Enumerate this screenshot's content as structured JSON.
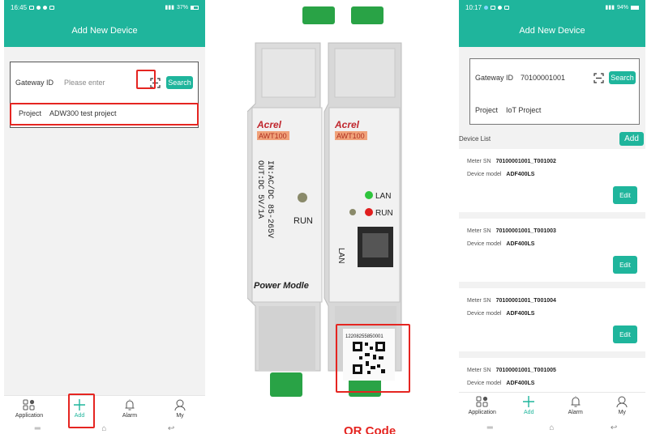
{
  "left_phone": {
    "status_time": "16:45",
    "status_battery": "37%",
    "title": "Add New Device",
    "gateway_label": "Gateway ID",
    "gateway_placeholder": "Please enter",
    "search_label": "Search",
    "project_label": "Project",
    "project_value": "ADW300 test project",
    "nav": [
      {
        "label": "Application",
        "icon": "application-grid-icon"
      },
      {
        "label": "Add",
        "icon": "plus-icon"
      },
      {
        "label": "Alarm",
        "icon": "bell-icon"
      },
      {
        "label": "My",
        "icon": "person-icon"
      }
    ]
  },
  "device_photo": {
    "left_module": {
      "brand": "Acrel",
      "model": "AWT100",
      "spec_line1": "IN:AC/DC 85-265V",
      "spec_line2": "OUT:DC 5V/1A",
      "run_label": "RUN",
      "footer": "Power Modle"
    },
    "right_module": {
      "brand": "Acrel",
      "model": "AWT100",
      "lan_led": "LAN",
      "run_led": "RUN",
      "port_label": "LAN",
      "qr_number": "12208255850001"
    },
    "caption": "QR Code"
  },
  "right_phone": {
    "status_time": "10:17",
    "status_battery": "94%",
    "title": "Add New Device",
    "gateway_label": "Gateway ID",
    "gateway_value": "70100001001",
    "search_label": "Search",
    "project_label": "Project",
    "project_value": "IoT Project",
    "list_title": "Device List",
    "add_label": "Add",
    "meter_sn_label": "Meter SN",
    "device_model_label": "Device model",
    "edit_label": "Edit",
    "devices": [
      {
        "sn": "70100001001_T001002",
        "model": "ADF400LS"
      },
      {
        "sn": "70100001001_T001003",
        "model": "ADF400LS"
      },
      {
        "sn": "70100001001_T001004",
        "model": "ADF400LS"
      },
      {
        "sn": "70100001001_T001005",
        "model": "ADF400LS"
      }
    ],
    "nav": [
      {
        "label": "Application",
        "icon": "application-grid-icon"
      },
      {
        "label": "Add",
        "icon": "plus-icon"
      },
      {
        "label": "Alarm",
        "icon": "bell-icon"
      },
      {
        "label": "My",
        "icon": "person-icon"
      }
    ]
  },
  "colors": {
    "accent": "#1fb59c",
    "highlight": "#e52521"
  }
}
